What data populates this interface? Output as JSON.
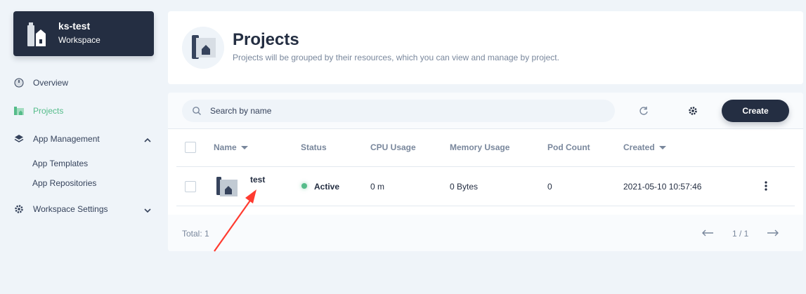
{
  "workspace": {
    "name": "ks-test",
    "label": "Workspace"
  },
  "sidebar": {
    "items": [
      {
        "label": "Overview",
        "icon": "dashboard-icon"
      },
      {
        "label": "Projects",
        "icon": "project-icon",
        "active": true
      },
      {
        "label": "App Management",
        "icon": "appcenter-icon",
        "expanded": true,
        "children": [
          "App Templates",
          "App Repositories"
        ]
      },
      {
        "label": "Workspace Settings",
        "icon": "gear-icon",
        "expanded": false
      }
    ]
  },
  "header": {
    "title": "Projects",
    "description": "Projects will be grouped by their resources, which you can view and manage by project."
  },
  "toolbar": {
    "search_placeholder": "Search by name",
    "create_label": "Create"
  },
  "table": {
    "columns": [
      "Name",
      "Status",
      "CPU Usage",
      "Memory Usage",
      "Pod Count",
      "Created"
    ],
    "rows": [
      {
        "name": "test",
        "status": "Active",
        "cpu": "0 m",
        "memory": "0 Bytes",
        "pods": "0",
        "created": "2021-05-10 10:57:46"
      }
    ]
  },
  "footer": {
    "total": "Total: 1",
    "page": "1 / 1"
  },
  "colors": {
    "accent": "#55bc8a",
    "dark": "#242e42",
    "annotation": "#ff3b30"
  }
}
